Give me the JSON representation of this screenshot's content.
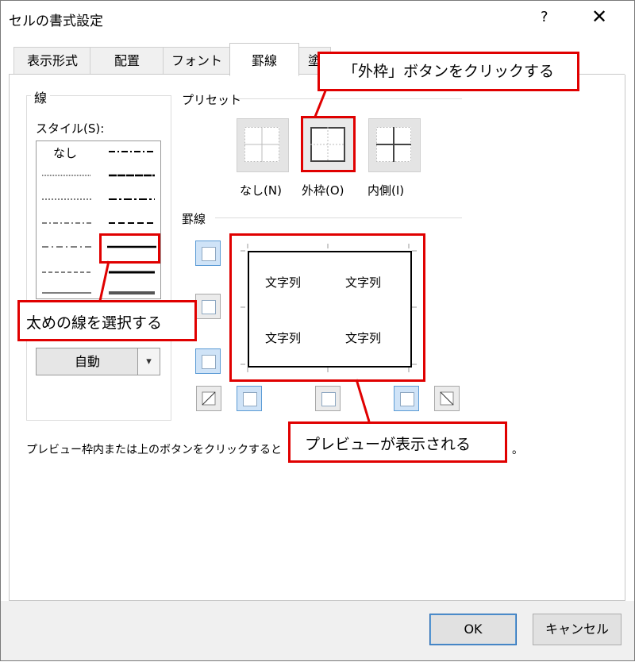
{
  "dialog": {
    "title": "セルの書式設定",
    "help_label": "?",
    "close_label": "✕"
  },
  "tabs": [
    {
      "label": "表示形式"
    },
    {
      "label": "配置"
    },
    {
      "label": "フォント"
    },
    {
      "label": "罫線"
    },
    {
      "label": "塗"
    }
  ],
  "active_tab": "罫線",
  "line_group": {
    "title": "線",
    "style_label": "スタイル(S):",
    "none_label": "なし",
    "selected_style": "thick solid",
    "color_value": "自動"
  },
  "presets": {
    "title": "プリセット",
    "items": [
      {
        "label": "なし(N)"
      },
      {
        "label": "外枠(O)"
      },
      {
        "label": "内側(I)"
      }
    ]
  },
  "borders": {
    "title": "罫線",
    "preview_cells": [
      "文字列",
      "文字列",
      "文字列",
      "文字列"
    ]
  },
  "hint": {
    "text": "プレビュー枠内または上のボタンをクリックすると",
    "tail": "。"
  },
  "annotations": {
    "outline": "「外枠」ボタンをクリックする",
    "thick": "太めの線を選択する",
    "preview": "プレビューが表示される"
  },
  "buttons": {
    "ok": "OK",
    "cancel": "キャンセル"
  },
  "colors": {
    "annotation_red": "#e00000",
    "active_blue": "#5b9bd5"
  }
}
